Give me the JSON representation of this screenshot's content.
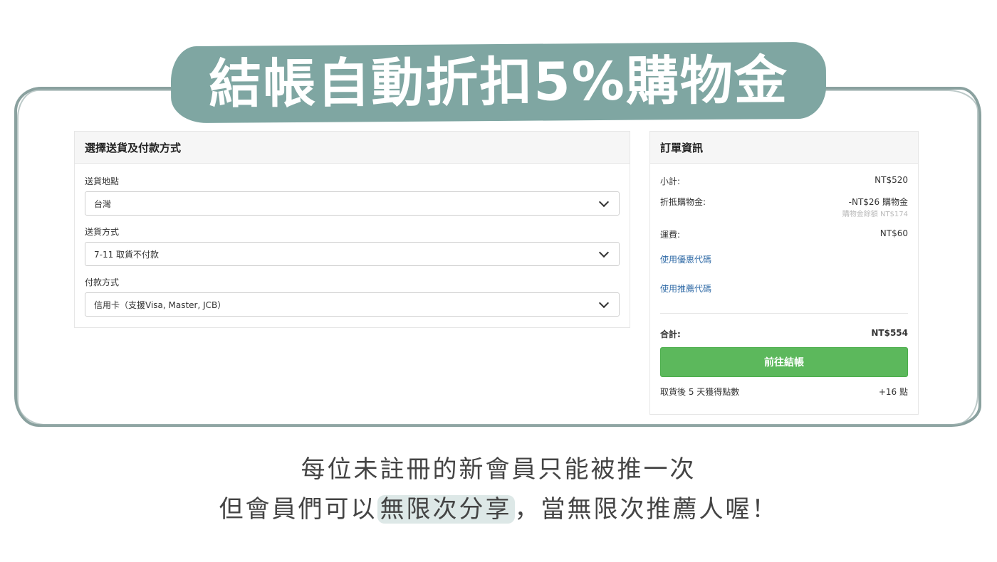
{
  "banner": {
    "title": "結帳自動折扣5%購物金"
  },
  "shipping_payment": {
    "title": "選擇送貨及付款方式",
    "location_label": "送貨地點",
    "location_value": "台灣",
    "method_label": "送貨方式",
    "method_value": "7-11 取貨不付款",
    "payment_label": "付款方式",
    "payment_value": "信用卡（支援Visa, Master, JCB）"
  },
  "order": {
    "title": "訂單資訊",
    "subtotal_label": "小計:",
    "subtotal_value": "NT$520",
    "credit_label": "折抵購物金:",
    "credit_value": "-NT$26 購物金",
    "credit_balance": "購物金餘額 NT$174",
    "shipping_label": "運費:",
    "shipping_value": "NT$60",
    "coupon_link": "使用優惠代碼",
    "referral_link": "使用推薦代碼",
    "total_label": "合計:",
    "total_value": "NT$554",
    "checkout_button": "前往結帳",
    "points_label": "取貨後 5 天獲得點數",
    "points_value": "+16 點"
  },
  "caption": {
    "line1": "每位未註冊的新會員只能被推一次",
    "line2_prefix": "但會員們可以",
    "line2_highlight": "無限次分享",
    "line2_suffix": "，當無限次推薦人喔！"
  },
  "colors": {
    "banner": "#7fa6a2",
    "checkout": "#5cb85c",
    "link": "#2f6aa6",
    "highlight": "#dde8e7"
  }
}
